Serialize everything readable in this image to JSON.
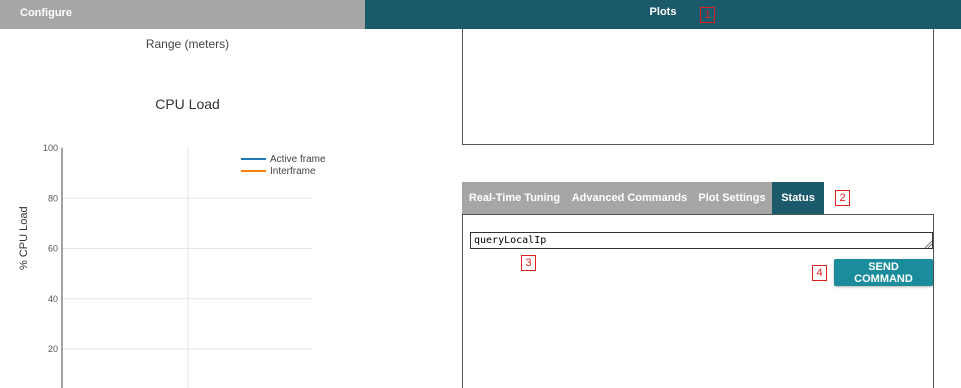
{
  "tabs": {
    "configure": "Configure",
    "plots": "Plots"
  },
  "markers": [
    "1",
    "2",
    "3",
    "4"
  ],
  "range_plot": {
    "label": "Range (meters)"
  },
  "chart_data": {
    "type": "line",
    "title": "CPU Load",
    "xlabel": "",
    "ylabel": "% CPU Load",
    "ylim": [
      0,
      100
    ],
    "yticks": [
      100,
      80,
      60,
      40,
      20
    ],
    "grid": true,
    "legend_placement": "top-right",
    "series": [
      {
        "name": "Active frame",
        "color": "#1f77b4",
        "values": []
      },
      {
        "name": "Interframe",
        "color": "#ff7f0e",
        "values": []
      }
    ]
  },
  "subtabs": {
    "items": [
      {
        "label": "Real-Time Tuning",
        "active": false
      },
      {
        "label": "Advanced Commands",
        "active": false
      },
      {
        "label": "Plot Settings",
        "active": false
      },
      {
        "label": "Status",
        "active": true
      }
    ]
  },
  "command": {
    "value": "queryLocalIp",
    "send_label": "SEND COMMAND"
  },
  "colors": {
    "active_tab": "#1b5a6b",
    "inactive_tab": "#a6a6a6",
    "button": "#1b8c9c",
    "marker": "#e0201f"
  }
}
